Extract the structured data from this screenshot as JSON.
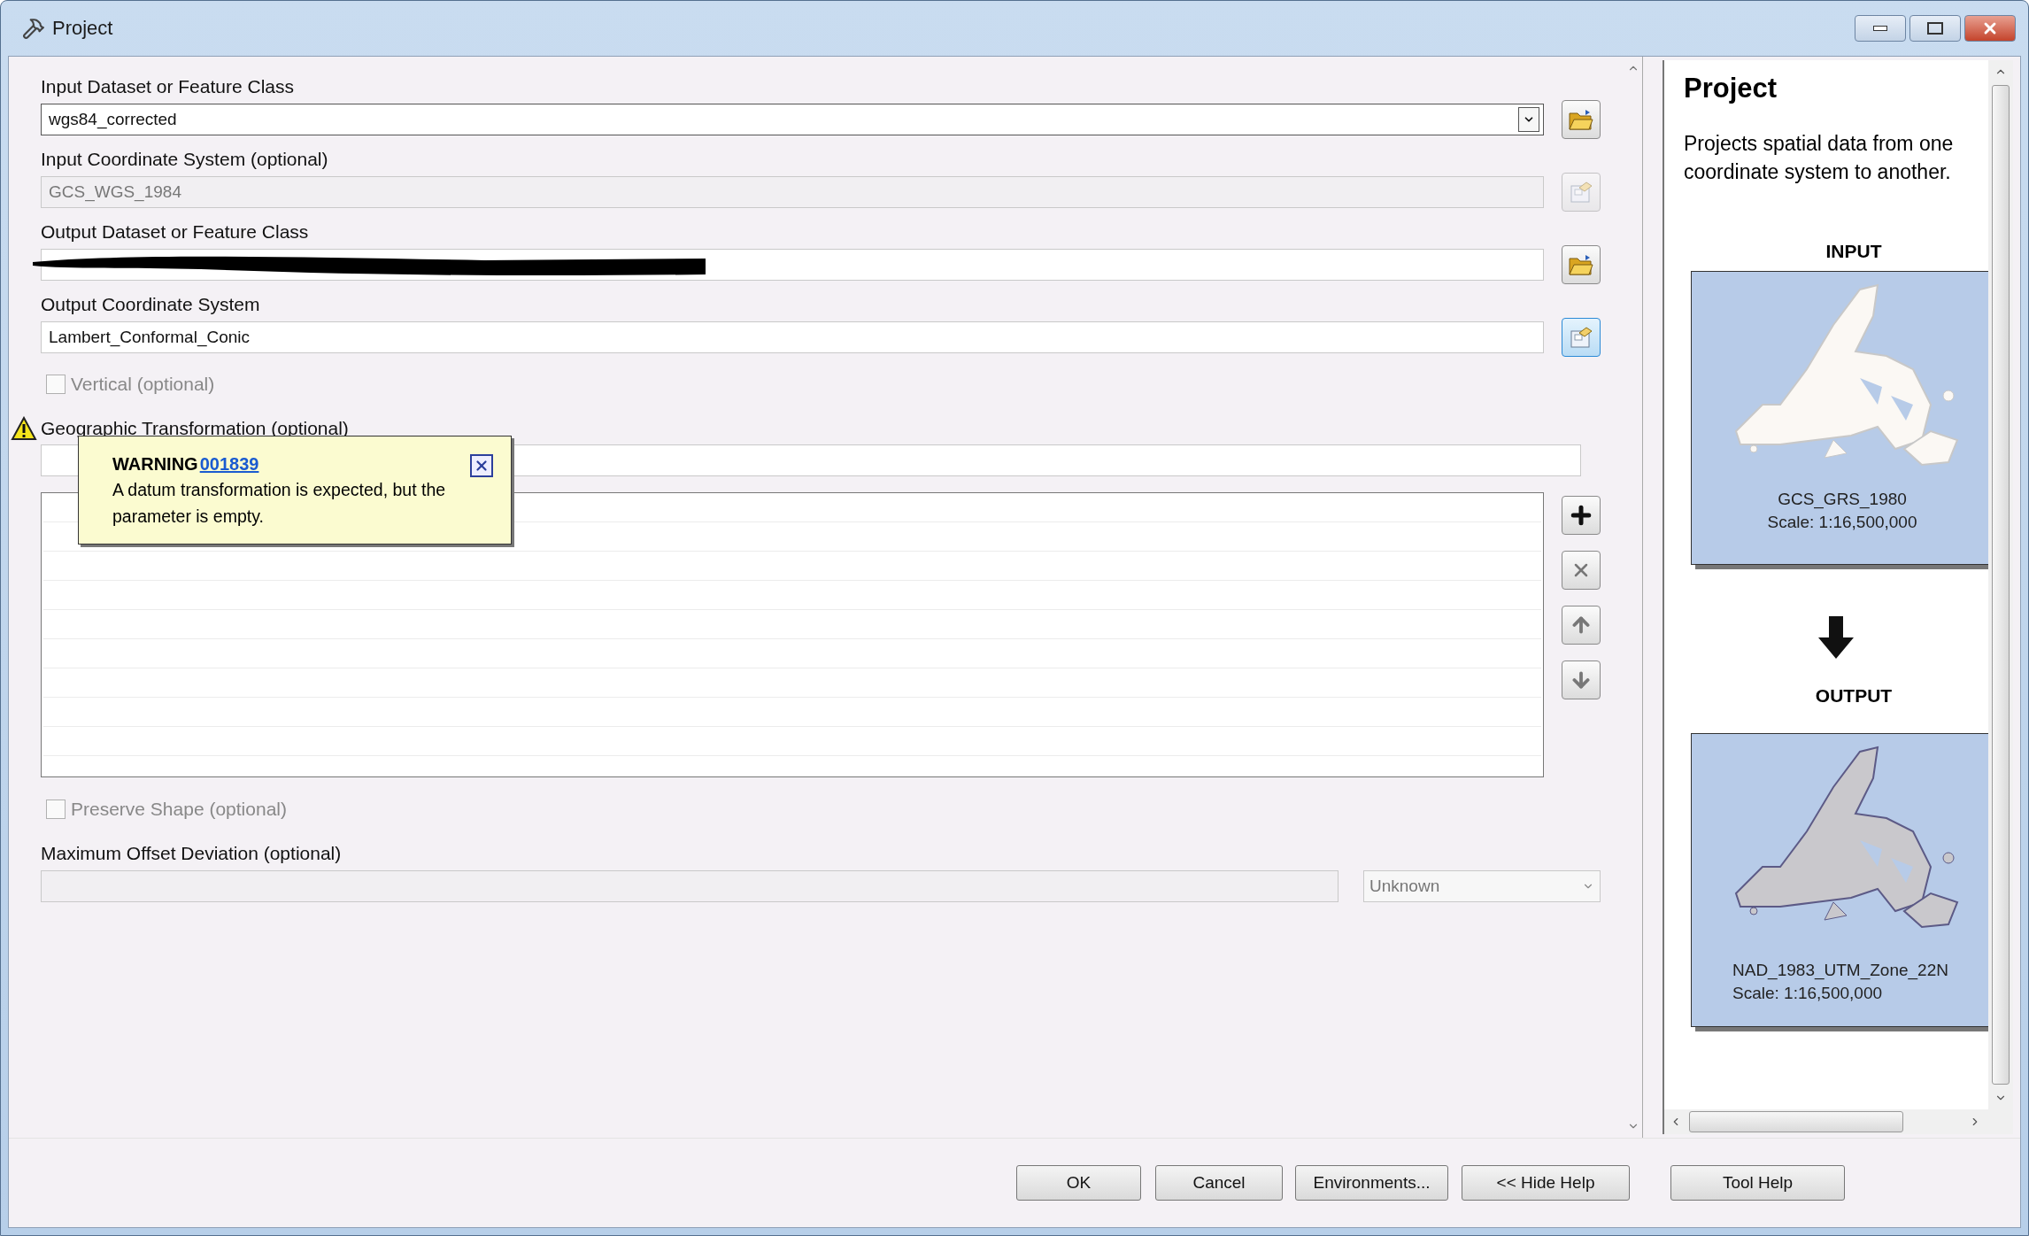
{
  "window": {
    "title": "Project"
  },
  "parameters": [
    {
      "kind": "dropdown",
      "label": "Input Dataset or Feature Class",
      "value": "wgs84_corrected",
      "disabled": false,
      "button": {
        "kind": "folder",
        "focused": false
      }
    },
    {
      "kind": "text",
      "label": "Input Coordinate System (optional)",
      "value": "GCS_WGS_1984",
      "disabled": true,
      "button": {
        "kind": "properties",
        "focused": false
      }
    },
    {
      "kind": "text",
      "label": "Output Dataset or Feature Class",
      "redacted": true,
      "disabled": false,
      "button": {
        "kind": "folder",
        "focused": false
      }
    },
    {
      "kind": "text",
      "label": "Output Coordinate System",
      "value": "Lambert_Conformal_Conic",
      "disabled": false,
      "button": {
        "kind": "properties",
        "focused": true
      }
    },
    {
      "kind": "checkbox",
      "label": "Vertical (optional)",
      "checked": false,
      "disabled": true
    },
    {
      "kind": "list",
      "label": "Geographic Transformation (optional)",
      "warning": true
    },
    {
      "kind": "checkbox",
      "label": "Preserve Shape (optional)",
      "checked": false,
      "disabled": true
    },
    {
      "kind": "number",
      "label": "Maximum Offset Deviation (optional)",
      "unit": "Unknown",
      "disabled": true
    }
  ],
  "warning_tip": {
    "title": "WARNING",
    "code": "001839",
    "message": "A datum transformation is expected, but the parameter is empty."
  },
  "help": {
    "title": "Project",
    "description": "Projects spatial data from one coordinate system to another.",
    "input_heading": "INPUT",
    "input_caption": [
      "GCS_GRS_1980",
      "Scale: 1:16,500,000"
    ],
    "output_heading": "OUTPUT",
    "output_caption": [
      "NAD_1983_UTM_Zone_22N",
      "Scale: 1:16,500,000"
    ]
  },
  "buttons": [
    "OK",
    "Cancel",
    "Environments...",
    "<< Hide Help",
    "Tool Help"
  ]
}
